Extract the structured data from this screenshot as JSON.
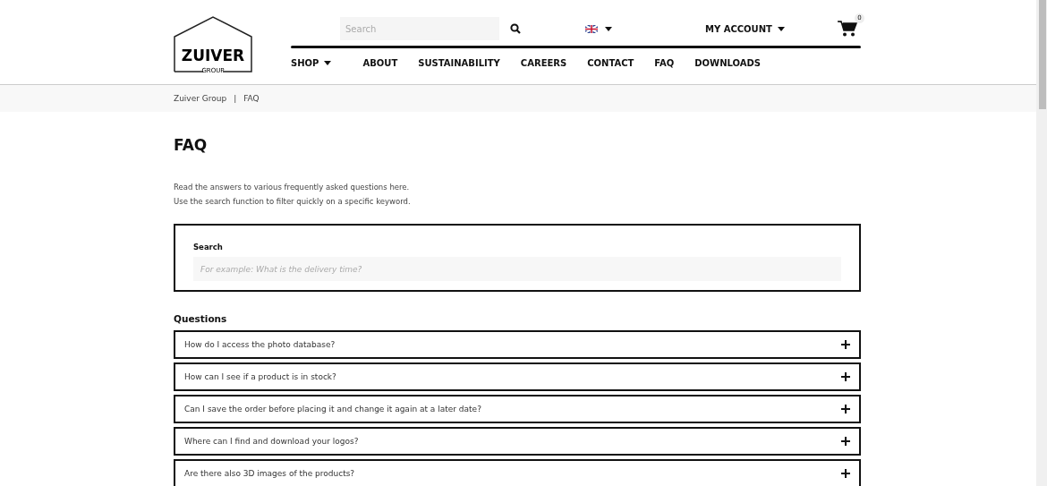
{
  "header": {
    "logo": {
      "name": "ZUIVER",
      "sub": "GROUP"
    },
    "search": {
      "placeholder": "Search"
    },
    "account": "MY ACCOUNT",
    "cart_count": "0",
    "nav": [
      {
        "label": "SHOP",
        "dropdown": true
      },
      {
        "label": "ABOUT",
        "dropdown": false
      },
      {
        "label": "SUSTAINABILITY",
        "dropdown": false
      },
      {
        "label": "CAREERS",
        "dropdown": false
      },
      {
        "label": "CONTACT",
        "dropdown": false
      },
      {
        "label": "FAQ",
        "dropdown": false
      },
      {
        "label": "DOWNLOADS",
        "dropdown": false
      }
    ]
  },
  "breadcrumb": {
    "separator": "|",
    "items": [
      "Zuiver Group",
      "FAQ"
    ]
  },
  "page": {
    "title": "FAQ",
    "intro": [
      "Read the answers to various frequently asked questions here.",
      "Use the search function to filter quickly on a specific keyword."
    ],
    "search": {
      "label": "Search",
      "placeholder": "For example: What is the delivery time?"
    },
    "questions_heading": "Questions",
    "questions": [
      {
        "text": "How do I access the photo database?",
        "expanded": false
      },
      {
        "text": "How can I see if a product is in stock?",
        "expanded": false
      },
      {
        "text": "Can I save the order before placing it and change it again at a later date?",
        "expanded": false
      },
      {
        "text": "Where can I find and download your logos?",
        "expanded": false
      },
      {
        "text": "Are there also 3D images of the products?",
        "expanded": false
      }
    ]
  }
}
